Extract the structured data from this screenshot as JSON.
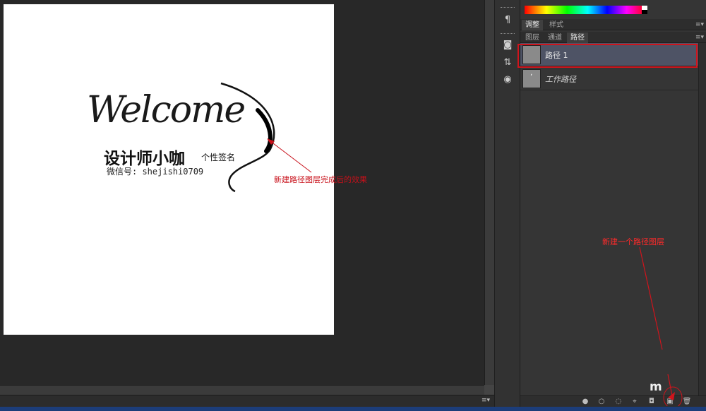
{
  "canvas": {
    "welcome_text": "Welcome",
    "signature_name": "设计师小咖",
    "signature_subtitle": "个性签名",
    "wechat_line": "微信号: shejishi0709",
    "annotation": "新建路径图层完成后的效果"
  },
  "status_bar": {
    "menu_glyph": "≡▾"
  },
  "dock": {
    "icons": [
      "paragraph-icon",
      "adjust-icon",
      "swap-icon",
      "record-icon"
    ],
    "glyphs": [
      "¶",
      "◙",
      "⇅",
      "◉"
    ]
  },
  "adjust_panel": {
    "tabs": [
      "调整",
      "样式"
    ],
    "active_tab": "调整",
    "menu_glyph": "≡▾"
  },
  "layers_panel": {
    "tabs": [
      "图层",
      "通道",
      "路径"
    ],
    "active_tab": "路径",
    "menu_glyph": "≡▾"
  },
  "paths": [
    {
      "name": "路径 1",
      "selected": true,
      "italic": false
    },
    {
      "name": "工作路径",
      "selected": false,
      "italic": true
    }
  ],
  "footer_buttons": [
    {
      "name": "fill-path-icon",
      "glyph": "●"
    },
    {
      "name": "stroke-path-icon",
      "glyph": "○"
    },
    {
      "name": "load-selection-icon",
      "glyph": "◌"
    },
    {
      "name": "make-work-path-icon",
      "glyph": "⌖"
    },
    {
      "name": "add-mask-icon",
      "glyph": "◘"
    },
    {
      "name": "new-path-icon",
      "glyph": "▣"
    },
    {
      "name": "delete-path-icon",
      "glyph": "🗑"
    }
  ],
  "panel_annotation": "新建一个路径图层",
  "colors": {
    "selected_row": "#4e5365",
    "annotation_red": "#c8101a",
    "canvas_bg": "#ffffff",
    "app_bg": "#282828"
  }
}
